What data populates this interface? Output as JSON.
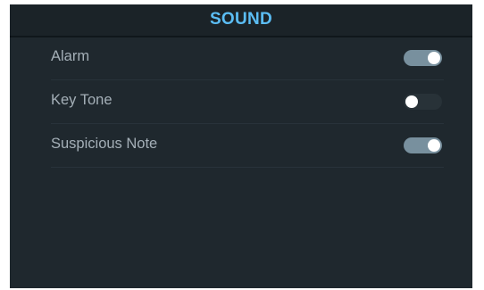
{
  "header": {
    "title": "SOUND"
  },
  "settings": [
    {
      "label": "Alarm",
      "enabled": true
    },
    {
      "label": "Key Tone",
      "enabled": false
    },
    {
      "label": "Suspicious Note",
      "enabled": true
    }
  ],
  "colors": {
    "title": "#5bbdf4",
    "panel_background": "#1f282e",
    "toggle_on": "#78909e",
    "toggle_off": "#283238"
  }
}
